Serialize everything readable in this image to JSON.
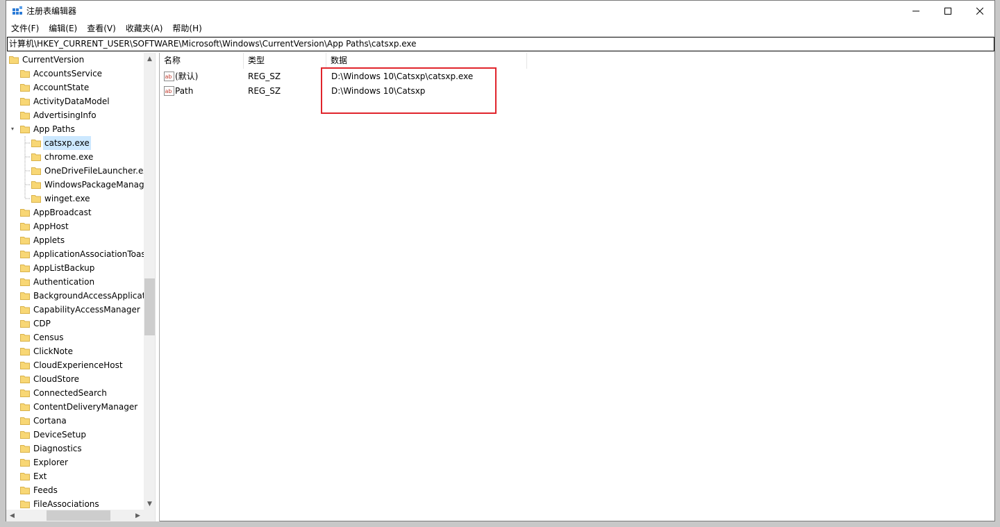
{
  "window": {
    "title": "注册表编辑器"
  },
  "menu": [
    "文件(F)",
    "编辑(E)",
    "查看(V)",
    "收藏夹(A)",
    "帮助(H)"
  ],
  "address": "计算机\\HKEY_CURRENT_USER\\SOFTWARE\\Microsoft\\Windows\\CurrentVersion\\App Paths\\catsxp.exe",
  "tree": {
    "items": [
      {
        "label": "CurrentVersion",
        "level": 0
      },
      {
        "label": "AccountsService",
        "level": 1
      },
      {
        "label": "AccountState",
        "level": 1
      },
      {
        "label": "ActivityDataModel",
        "level": 1
      },
      {
        "label": "AdvertisingInfo",
        "level": 1
      },
      {
        "label": "App Paths",
        "level": 1,
        "expanded": true
      },
      {
        "label": "catsxp.exe",
        "level": 2,
        "selected": true
      },
      {
        "label": "chrome.exe",
        "level": 2
      },
      {
        "label": "OneDriveFileLauncher.exe",
        "level": 2
      },
      {
        "label": "WindowsPackageManager",
        "level": 2
      },
      {
        "label": "winget.exe",
        "level": 2
      },
      {
        "label": "AppBroadcast",
        "level": 1
      },
      {
        "label": "AppHost",
        "level": 1
      },
      {
        "label": "Applets",
        "level": 1
      },
      {
        "label": "ApplicationAssociationToasts",
        "level": 1
      },
      {
        "label": "AppListBackup",
        "level": 1
      },
      {
        "label": "Authentication",
        "level": 1
      },
      {
        "label": "BackgroundAccessApplications",
        "level": 1
      },
      {
        "label": "CapabilityAccessManager",
        "level": 1
      },
      {
        "label": "CDP",
        "level": 1
      },
      {
        "label": "Census",
        "level": 1
      },
      {
        "label": "ClickNote",
        "level": 1
      },
      {
        "label": "CloudExperienceHost",
        "level": 1
      },
      {
        "label": "CloudStore",
        "level": 1
      },
      {
        "label": "ConnectedSearch",
        "level": 1
      },
      {
        "label": "ContentDeliveryManager",
        "level": 1
      },
      {
        "label": "Cortana",
        "level": 1
      },
      {
        "label": "DeviceSetup",
        "level": 1
      },
      {
        "label": "Diagnostics",
        "level": 1
      },
      {
        "label": "Explorer",
        "level": 1
      },
      {
        "label": "Ext",
        "level": 1
      },
      {
        "label": "Feeds",
        "level": 1
      },
      {
        "label": "FileAssociations",
        "level": 1
      }
    ]
  },
  "columns": [
    "名称",
    "类型",
    "数据"
  ],
  "values": [
    {
      "name": "(默认)",
      "type": "REG_SZ",
      "data": "D:\\Windows 10\\Catsxp\\catsxp.exe"
    },
    {
      "name": "Path",
      "type": "REG_SZ",
      "data": "D:\\Windows 10\\Catsxp"
    }
  ],
  "colors": {
    "highlight_box": "#e0242b",
    "selection": "#cce8ff",
    "folder": "#f8d775"
  }
}
